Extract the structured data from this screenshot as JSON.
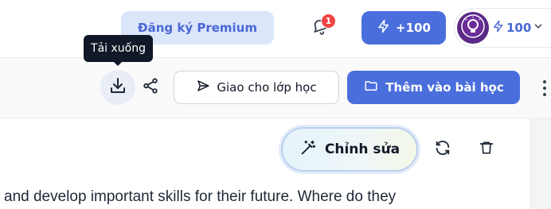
{
  "header": {
    "premium_button": "Đăng ký Premium",
    "notifications": {
      "icon": "bell-icon",
      "count": "1"
    },
    "bonus_button": {
      "icon": "lightning-icon",
      "label": "+100"
    },
    "user": {
      "avatar_icon": "owl-lightbulb-avatar",
      "credits": "100",
      "credits_icon": "lightning-icon",
      "menu_icon": "chevron-down-icon"
    }
  },
  "tooltip": {
    "label": "Tải xuống"
  },
  "toolbar": {
    "download_icon": "download-icon",
    "share_icon": "share-icon",
    "assign_button": {
      "icon": "send-icon",
      "label": "Giao cho lớp học"
    },
    "add_button": {
      "icon": "folder-icon",
      "label": "Thêm vào bài học"
    },
    "more_icon": "more-vertical-icon"
  },
  "content": {
    "edit_button": {
      "icon": "magic-wand-icon",
      "label": "Chỉnh sửa"
    },
    "refresh_icon": "refresh-icon",
    "delete_icon": "trash-icon",
    "text": "and develop important skills for their future. Where do they"
  },
  "colors": {
    "accent": "#4a6fdc",
    "premium_bg": "#dbe6fb",
    "badge": "#ef4444",
    "tooltip_bg": "#111827"
  }
}
